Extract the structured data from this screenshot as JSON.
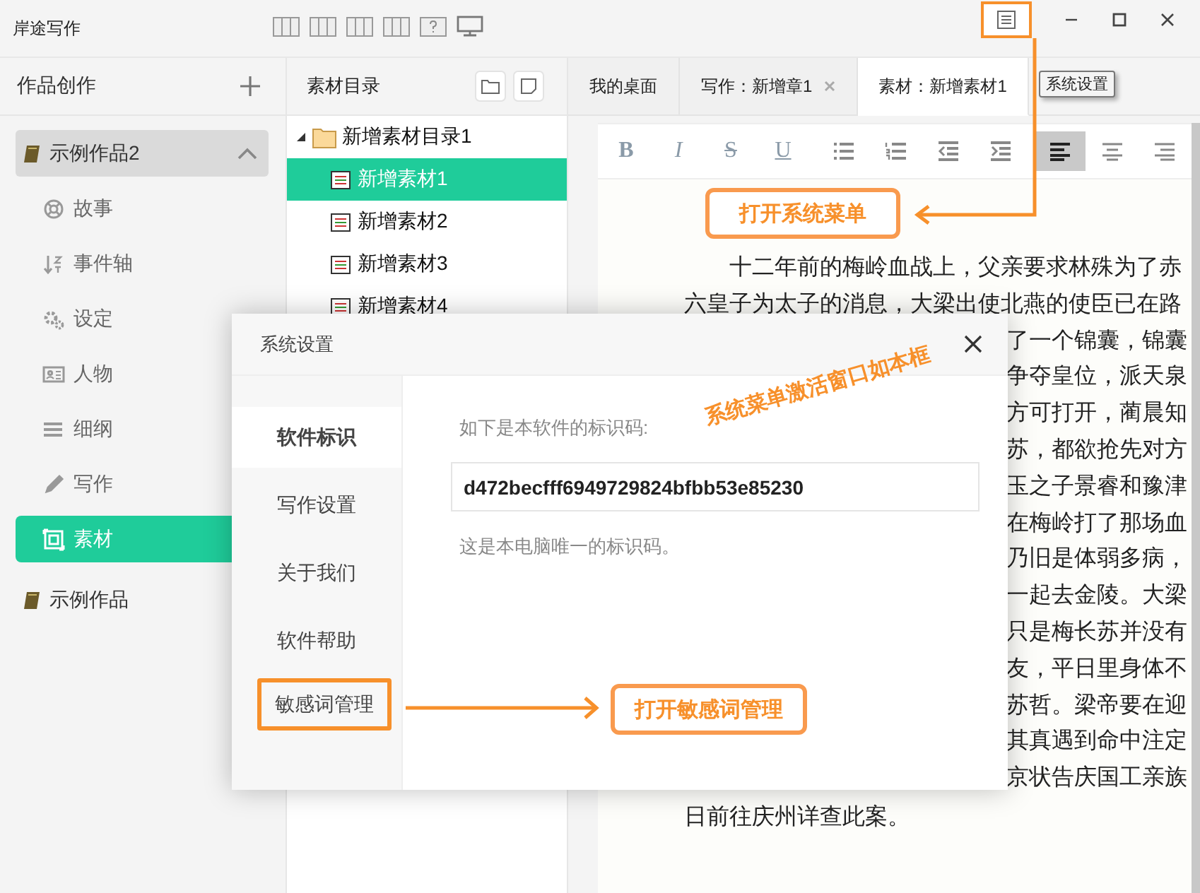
{
  "app_title": "岸途写作",
  "sidebar": {
    "title": "作品创作",
    "works": [
      {
        "title": "示例作品2",
        "expanded": true,
        "children": [
          {
            "label": "故事",
            "kind": "story",
            "selected": false
          },
          {
            "label": "事件轴",
            "kind": "timeline",
            "selected": false
          },
          {
            "label": "设定",
            "kind": "setting",
            "selected": false
          },
          {
            "label": "人物",
            "kind": "character",
            "selected": false
          },
          {
            "label": "细纲",
            "kind": "outline",
            "selected": false
          },
          {
            "label": "写作",
            "kind": "writing",
            "selected": false
          },
          {
            "label": "素材",
            "kind": "material",
            "selected": true
          }
        ]
      },
      {
        "title": "示例作品",
        "expanded": false
      }
    ]
  },
  "material_tree": {
    "title": "素材目录",
    "folders": [
      {
        "label": "新增素材目录1",
        "expanded": true,
        "children": [
          {
            "label": "新增素材1",
            "selected": true
          },
          {
            "label": "新增素材2",
            "selected": false
          },
          {
            "label": "新增素材3",
            "selected": false
          },
          {
            "label": "新增素材4",
            "selected": false
          }
        ]
      }
    ]
  },
  "tabs": [
    {
      "label": "我的桌面",
      "selected": false,
      "closable": false
    },
    {
      "label": "写作：新增章1",
      "selected": false,
      "closable": true
    },
    {
      "label": "素材：新增素材1",
      "selected": true,
      "closable": false
    }
  ],
  "tooltip": "系统设置",
  "editor": {
    "toolbar": [
      {
        "kind": "bold",
        "label": "B",
        "selected": false
      },
      {
        "kind": "italic",
        "label": "I",
        "selected": false
      },
      {
        "kind": "strike",
        "label": "S",
        "selected": false
      },
      {
        "kind": "underline",
        "label": "U",
        "selected": false
      },
      {
        "kind": "bullets",
        "selected": false
      },
      {
        "kind": "numbers",
        "selected": false
      },
      {
        "kind": "outdent",
        "selected": false
      },
      {
        "kind": "indent",
        "selected": false
      },
      {
        "kind": "align-left",
        "selected": true
      },
      {
        "kind": "align-center",
        "selected": false
      },
      {
        "kind": "align-right",
        "selected": false
      }
    ],
    "lines": [
      {
        "kind": "first",
        "text": "十二年前的梅岭血战上，父亲要求林殊为了赤"
      },
      {
        "kind": "full",
        "text": "六皇子为太子的消息，大梁出使北燕的使臣已在路"
      },
      {
        "kind": "fragment",
        "text": "了一个锦囊，锦囊"
      },
      {
        "kind": "fragment",
        "text": "争夺皇位，派天泉"
      },
      {
        "kind": "fragment",
        "text": "方可打开，蔺晨知"
      },
      {
        "kind": "fragment",
        "text": "苏，都欲抢先对方"
      },
      {
        "kind": "fragment",
        "text": "玉之子景睿和豫津"
      },
      {
        "kind": "fragment",
        "text": "在梅岭打了那场血"
      },
      {
        "kind": "fragment",
        "text": "乃旧是体弱多病，"
      },
      {
        "kind": "fragment",
        "text": "一起去金陵。大梁"
      },
      {
        "kind": "fragment",
        "text": "只是梅长苏并没有"
      },
      {
        "kind": "fragment",
        "text": "友，平日里身体不"
      },
      {
        "kind": "fragment",
        "text": "苏哲。梁帝要在迎"
      },
      {
        "kind": "fragment",
        "text": "其真遇到命中注定"
      },
      {
        "kind": "fragment",
        "text": "京状告庆国工亲族"
      },
      {
        "kind": "full",
        "text": "日前往庆州详查此案。"
      }
    ]
  },
  "dialog": {
    "title": "系统设置",
    "menu": [
      {
        "label": "软件标识",
        "selected": true,
        "highlighted": false
      },
      {
        "label": "写作设置",
        "selected": false,
        "highlighted": false
      },
      {
        "label": "关于我们",
        "selected": false,
        "highlighted": false
      },
      {
        "label": "软件帮助",
        "selected": false,
        "highlighted": false
      },
      {
        "label": "敏感词管理",
        "selected": false,
        "highlighted": true
      }
    ],
    "prompt": "如下是本软件的标识码:",
    "code": "d472becfff6949729824bfbb53e85230",
    "note": "这是本电脑唯一的标识码。"
  },
  "annotations": {
    "menu_callout": "打开系统菜单",
    "dialog_note": "系统菜单激活窗口如本框",
    "sensitive_callout": "打开敏感词管理"
  }
}
